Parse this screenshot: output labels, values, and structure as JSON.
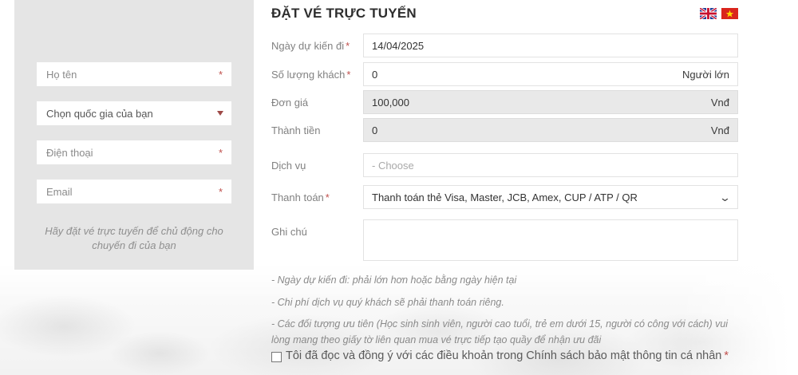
{
  "required_mark": "*",
  "header": {
    "title": "ĐẶT VÉ TRỰC TUYẾN",
    "lang_icons": [
      "uk-flag",
      "vietnam-flag"
    ]
  },
  "sidebar": {
    "name_placeholder": "Họ tên",
    "country_placeholder": "Chọn quốc gia của bạn",
    "phone_placeholder": "Điện thoại",
    "email_placeholder": "Email",
    "tagline": "Hãy đặt vé trực tuyến để chủ động cho chuyến đi của bạn"
  },
  "form": {
    "date": {
      "label": "Ngày dự kiến đi",
      "value": "14/04/2025"
    },
    "guests": {
      "label": "Số lượng khách",
      "value": "0",
      "unit": "Người lớn"
    },
    "price": {
      "label": "Đơn giá",
      "value": "100,000",
      "unit": "Vnđ"
    },
    "total": {
      "label": "Thành tiền",
      "value": "0",
      "unit": "Vnđ"
    },
    "service": {
      "label": "Dịch vụ",
      "placeholder": "- Choose"
    },
    "payment": {
      "label": "Thanh toán",
      "value": "Thanh toán thẻ Visa, Master, JCB, Amex, CUP / ATP / QR",
      "chevron": "⌄"
    },
    "note": {
      "label": "Ghi chú"
    },
    "notes": [
      "- Ngày dự kiến đi: phải lớn hơn hoặc bằng ngày hiện tại",
      "- Chi phí dịch vụ quý khách sẽ phải thanh toán riêng.",
      "- Các đối tượng ưu tiên (Học sinh sinh viên, người cao tuổi, trẻ em dưới 15, người có công với cách) vui lòng mang theo giấy tờ liên quan mua vé trực tiếp tạo quầy để nhận ưu đãi"
    ],
    "agreement": "Tôi đã đọc và đồng ý với các điều khoản trong Chính sách bảo mật thông tin cá nhân"
  },
  "colors": {
    "accent_red": "#c0504d",
    "panel_gray": "#e5e5e5",
    "disabled_gray": "#e9e9e9"
  }
}
